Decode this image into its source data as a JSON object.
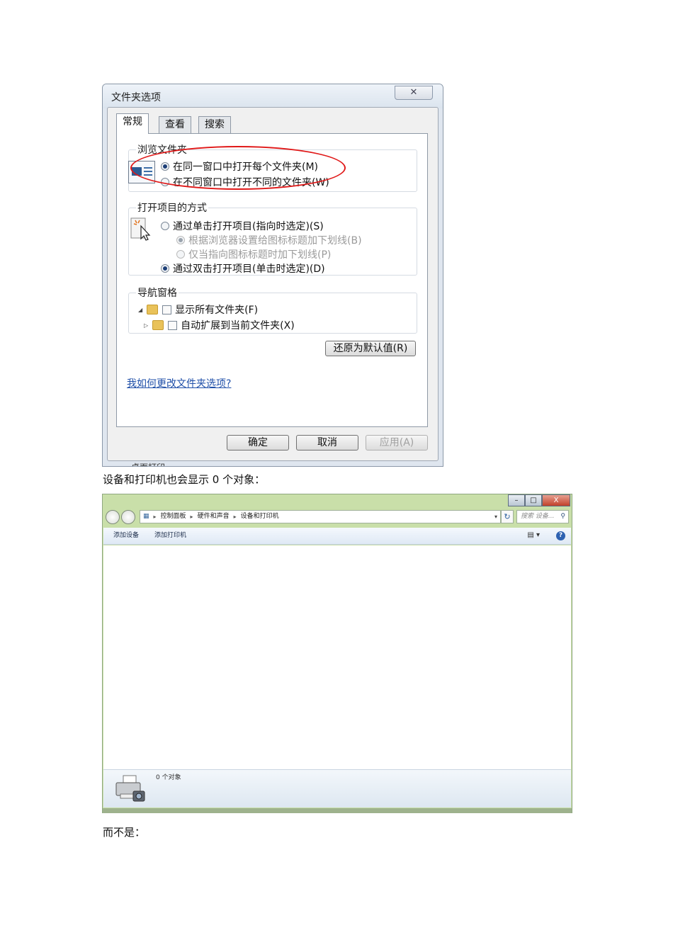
{
  "folder_options": {
    "title": "文件夹选项",
    "close_glyph": "✕",
    "tabs": [
      "常规",
      "查看",
      "搜索"
    ],
    "browse_group": {
      "title": "浏览文件夹",
      "options": [
        "在同一窗口中打开每个文件夹(M)",
        "在不同窗口中打开不同的文件夹(W)"
      ],
      "selected_index": 0
    },
    "click_group": {
      "title": "打开项目的方式",
      "single_click": "通过单击打开项目(指向时选定)(S)",
      "sub_options": [
        "根据浏览器设置给图标标题加下划线(B)",
        "仅当指向图标标题时加下划线(P)"
      ],
      "double_click": "通过双击打开项目(单击时选定)(D)",
      "selected": "double_click"
    },
    "nav_group": {
      "title": "导航窗格",
      "checks": [
        "显示所有文件夹(F)",
        "自动扩展到当前文件夹(X)"
      ]
    },
    "restore_button": "还原为默认值(R)",
    "help_link": "我如何更改文件夹选项?",
    "buttons": {
      "ok": "确定",
      "cancel": "取消",
      "apply": "应用(A)"
    },
    "cut_off_text": "桌面打印"
  },
  "paragraph_1": "设备和打印机也会显示 0 个对象：",
  "devices_window": {
    "caption_buttons": [
      "–",
      "□",
      "X"
    ],
    "breadcrumb": [
      "控制面板",
      "硬件和声音",
      "设备和打印机"
    ],
    "search_placeholder": "搜索 设备...",
    "commands": [
      "添加设备",
      "添加打印机"
    ],
    "status": "0 个对象",
    "accent_colors": {
      "frame": "#c9dfa9",
      "help": "#2e62b1"
    }
  },
  "paragraph_2": "而不是："
}
